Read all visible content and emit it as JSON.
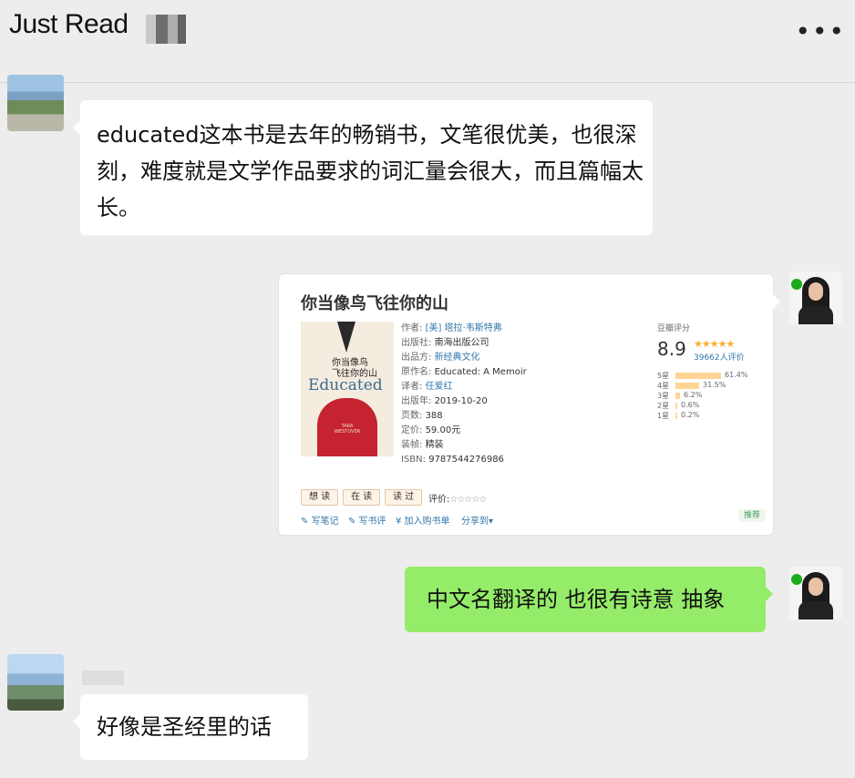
{
  "header": {
    "title": "Just Read",
    "more_label": "•••"
  },
  "messages": {
    "m1": {
      "text": "educated这本书是去年的畅销书，文笔很优美，也很深刻，难度就是文学作品要求的词汇量会很大，而且篇幅太长。"
    },
    "m2": {
      "text": "中文名翻译的 也很有诗意 抽象"
    },
    "m3": {
      "text": "好像是圣经里的话"
    }
  },
  "book": {
    "title": "你当像鸟飞往你的山",
    "cover": {
      "cn_title_line1": "你当像鸟",
      "cn_title_line2": "飞往你的山",
      "en_title": "Educated",
      "author_en": "TARA WESTOVER"
    },
    "meta": [
      {
        "label": "作者:",
        "value": "[美] 塔拉·韦斯特弗",
        "link": true
      },
      {
        "label": "出版社:",
        "value": "南海出版公司",
        "link": false
      },
      {
        "label": "出品方:",
        "value": "新经典文化",
        "link": true
      },
      {
        "label": "原作名:",
        "value": "Educated: A Memoir",
        "link": false
      },
      {
        "label": "译者:",
        "value": "任爱红",
        "link": true
      },
      {
        "label": "出版年:",
        "value": "2019-10-20",
        "link": false
      },
      {
        "label": "页数:",
        "value": "388",
        "link": false
      },
      {
        "label": "定价:",
        "value": "59.00元",
        "link": false
      },
      {
        "label": "装帧:",
        "value": "精装",
        "link": false
      },
      {
        "label": "ISBN:",
        "value": "9787544276986",
        "link": false
      }
    ],
    "rating": {
      "header": "豆瓣评分",
      "score": "8.9",
      "stars": "★★★★★",
      "count": "39662人评价",
      "distribution": [
        {
          "label": "5星",
          "percent": "61.4%",
          "value": 61.4
        },
        {
          "label": "4星",
          "percent": "31.5%",
          "value": 31.5
        },
        {
          "label": "3星",
          "percent": "6.2%",
          "value": 6.2
        },
        {
          "label": "2星",
          "percent": "0.6%",
          "value": 0.6
        },
        {
          "label": "1星",
          "percent": "0.2%",
          "value": 0.2
        }
      ]
    },
    "buttons": {
      "want": "想 读",
      "reading": "在 读",
      "read": "读 过"
    },
    "rate_label": "评价:",
    "rate_stars": "☆☆☆☆☆",
    "actions": {
      "note": "✎ 写笔记",
      "review": "✎ 写书评",
      "cart": "¥ 加入购书单",
      "share": "分享到▾"
    },
    "recommend": "推荐"
  },
  "colors": {
    "bubble_right": "#95ec69",
    "bubble_left": "#ffffff",
    "background": "#ededed",
    "link": "#3377aa"
  }
}
